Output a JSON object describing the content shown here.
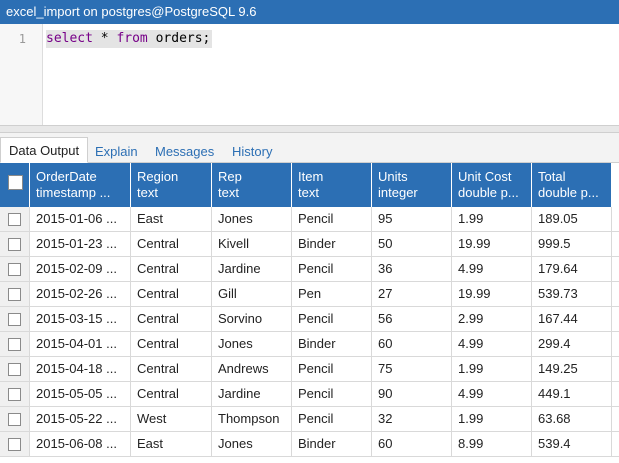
{
  "window": {
    "title": "excel_import on postgres@PostgreSQL 9.6"
  },
  "editor": {
    "line_number": "1",
    "query_kw1": "select",
    "query_mid": " * ",
    "query_kw2": "from",
    "query_rest": " orders;"
  },
  "tabs": [
    {
      "label": "Data Output",
      "active": true
    },
    {
      "label": "Explain",
      "active": false
    },
    {
      "label": "Messages",
      "active": false
    },
    {
      "label": "History",
      "active": false
    }
  ],
  "columns": [
    {
      "name": "OrderDate",
      "type": "timestamp ..."
    },
    {
      "name": "Region",
      "type": "text"
    },
    {
      "name": "Rep",
      "type": "text"
    },
    {
      "name": "Item",
      "type": "text"
    },
    {
      "name": "Units",
      "type": "integer"
    },
    {
      "name": "Unit Cost",
      "type": "double p..."
    },
    {
      "name": "Total",
      "type": "double p..."
    }
  ],
  "rows": [
    [
      "2015-01-06 ...",
      "East",
      "Jones",
      "Pencil",
      "95",
      "1.99",
      "189.05"
    ],
    [
      "2015-01-23 ...",
      "Central",
      "Kivell",
      "Binder",
      "50",
      "19.99",
      "999.5"
    ],
    [
      "2015-02-09 ...",
      "Central",
      "Jardine",
      "Pencil",
      "36",
      "4.99",
      "179.64"
    ],
    [
      "2015-02-26 ...",
      "Central",
      "Gill",
      "Pen",
      "27",
      "19.99",
      "539.73"
    ],
    [
      "2015-03-15 ...",
      "Central",
      "Sorvino",
      "Pencil",
      "56",
      "2.99",
      "167.44"
    ],
    [
      "2015-04-01 ...",
      "Central",
      "Jones",
      "Binder",
      "60",
      "4.99",
      "299.4"
    ],
    [
      "2015-04-18 ...",
      "Central",
      "Andrews",
      "Pencil",
      "75",
      "1.99",
      "149.25"
    ],
    [
      "2015-05-05 ...",
      "Central",
      "Jardine",
      "Pencil",
      "90",
      "4.99",
      "449.1"
    ],
    [
      "2015-05-22 ...",
      "West",
      "Thompson",
      "Pencil",
      "32",
      "1.99",
      "63.68"
    ],
    [
      "2015-06-08 ...",
      "East",
      "Jones",
      "Binder",
      "60",
      "8.99",
      "539.4"
    ]
  ],
  "colors": {
    "accent": "#2c6fb4",
    "keyword": "#770088"
  }
}
